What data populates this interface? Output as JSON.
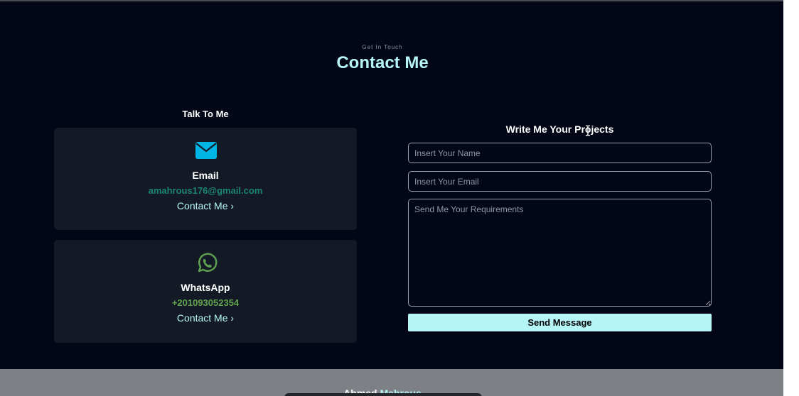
{
  "section": {
    "subtitle": "Get In Touch",
    "title": "Contact Me"
  },
  "talk": {
    "heading": "Talk To Me",
    "cards": [
      {
        "icon": "envelope-icon",
        "label": "Email",
        "value": "amahrous176@gmail.com",
        "link": "Contact Me",
        "icon_color": "#00b4e6",
        "value_color": "#1d8670"
      },
      {
        "icon": "whatsapp-icon",
        "label": "WhatsApp",
        "value": "+201093052354",
        "link": "Contact Me",
        "icon_color": "#5fa24f",
        "value_color": "#5fa24f"
      }
    ]
  },
  "form": {
    "heading": "Write Me Your Projects",
    "name_placeholder": "Insert Your Name",
    "email_placeholder": "Insert Your Email",
    "requirements_placeholder": "Send Me Your Requirements",
    "submit_label": "Send Message"
  },
  "footer": {
    "name_first": "Ahmed",
    "name_last": "Mahrous"
  },
  "colors": {
    "background": "#030616",
    "accent": "#b5f4f7",
    "card": "#141a25"
  }
}
